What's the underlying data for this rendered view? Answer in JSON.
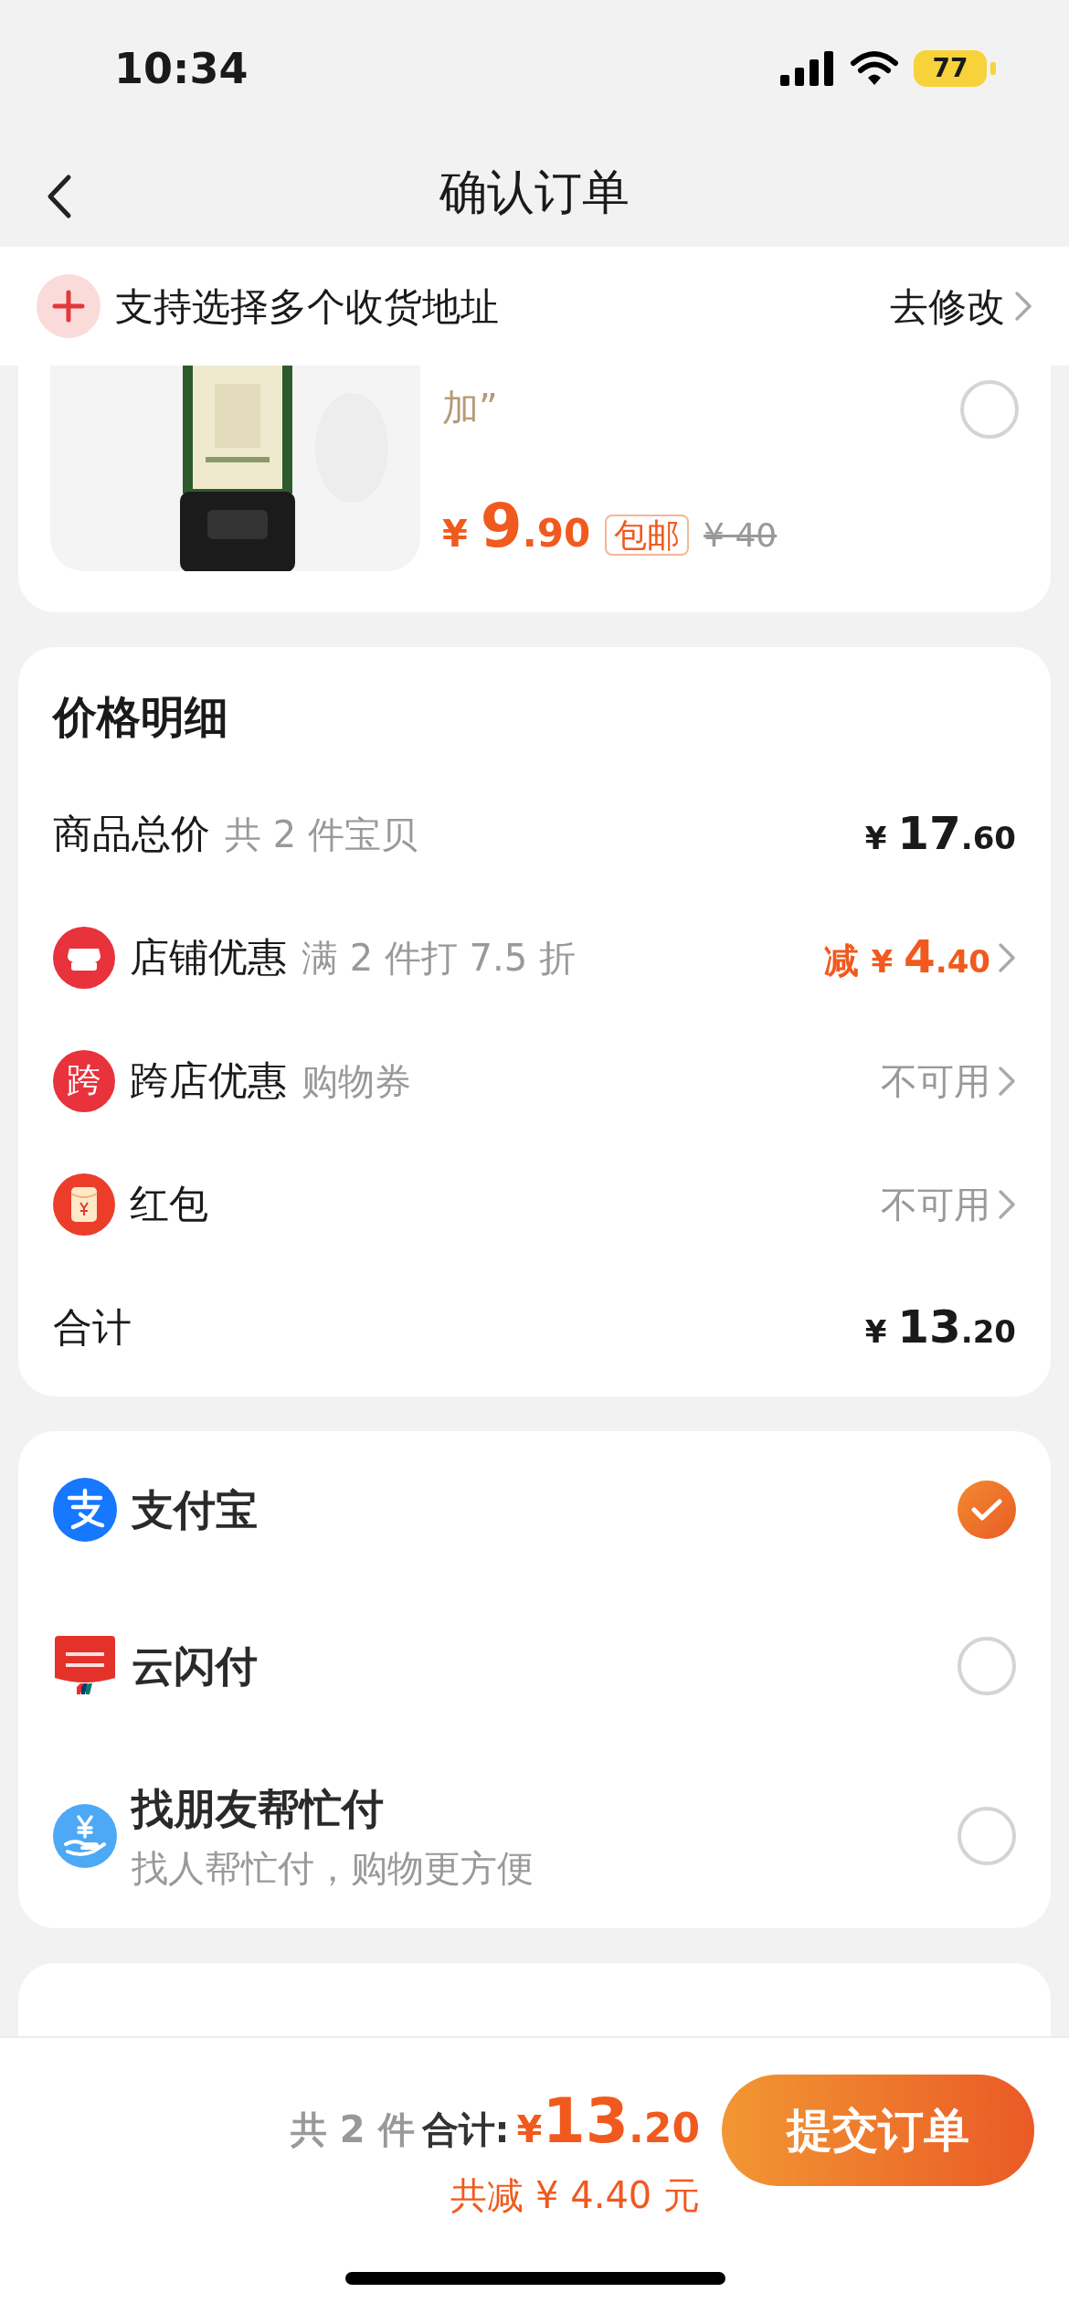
{
  "status_bar": {
    "time": "10:34",
    "battery": "77"
  },
  "nav": {
    "title": "确认订单"
  },
  "address_notice": {
    "text": "支持选择多个收货地址",
    "action": "去修改"
  },
  "product": {
    "description": "加”",
    "selected": false,
    "price": {
      "currency": "¥ ",
      "int": "9",
      "dec": ".90"
    },
    "tag": "包邮",
    "original_price": "¥ 40"
  },
  "price_detail": {
    "title": "价格明细",
    "rows": [
      {
        "kind": "total",
        "label": "商品总价",
        "note": "共 2 件宝贝",
        "amount": {
          "currency": "¥ ",
          "int": "17",
          "dec": ".60"
        }
      },
      {
        "kind": "store",
        "label": "店铺优惠",
        "note": "满 2 件打 7.5 折",
        "amount": {
          "prefix": "减 ",
          "currency": "¥ ",
          "int": "4",
          "dec": ".40"
        }
      },
      {
        "kind": "crossstore",
        "badge": "跨",
        "label": "跨店优惠",
        "note": "购物券",
        "status": "不可用"
      },
      {
        "kind": "envelope",
        "label": "红包",
        "status": "不可用"
      },
      {
        "kind": "total",
        "label": "合计",
        "amount": {
          "currency": "¥ ",
          "int": "13",
          "dec": ".20"
        }
      }
    ]
  },
  "payment_methods": [
    {
      "kind": "wallet",
      "name": "支付宝",
      "selected": true
    },
    {
      "kind": "card",
      "name": "云闪付",
      "selected": false
    },
    {
      "kind": "friend",
      "name": "找朋友帮忙付",
      "subtitle": "找人帮忙付，购物更方便",
      "selected": false
    }
  ],
  "footer": {
    "count": "共 2 件",
    "total_label": "合计:",
    "total": {
      "currency": "¥",
      "int": "13",
      "dec": ".20"
    },
    "saved": "共减 ¥ 4.40 元",
    "submit": "提交订单"
  }
}
